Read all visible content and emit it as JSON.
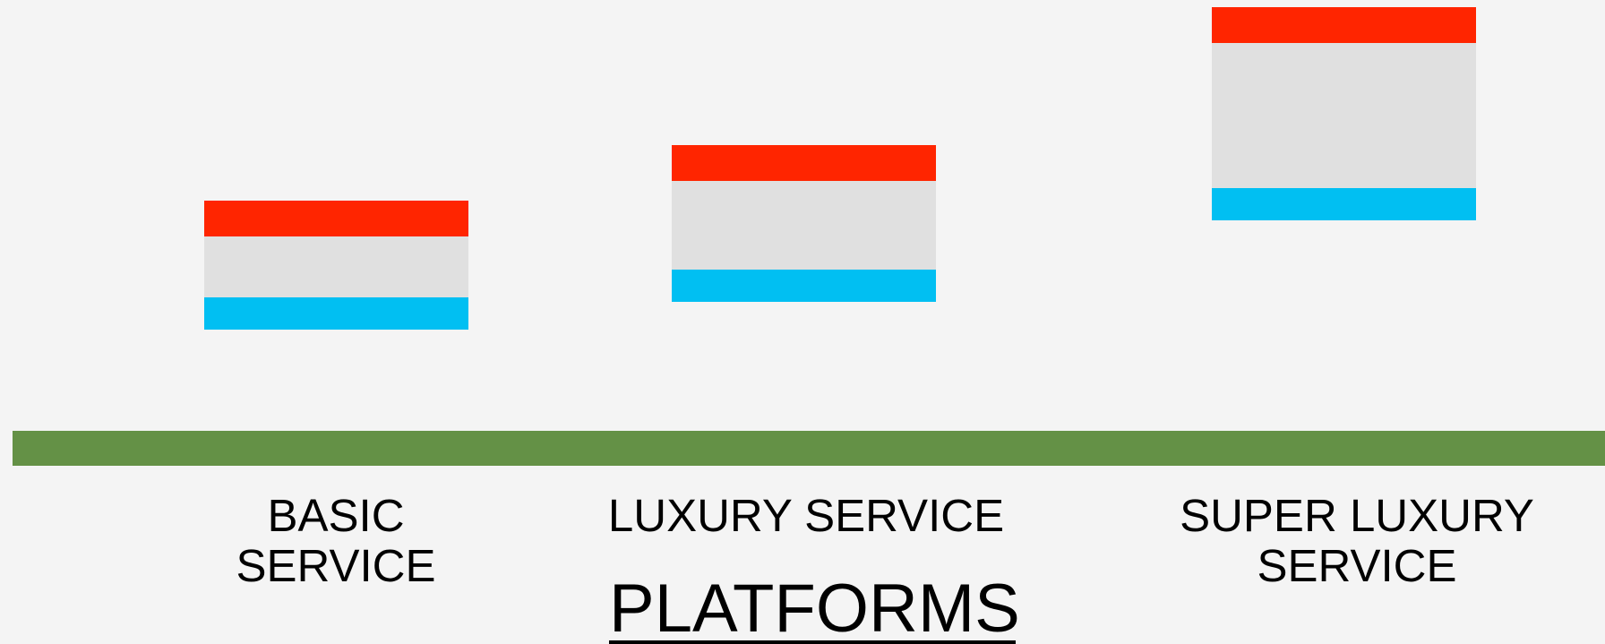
{
  "colors": {
    "background": "#f4f4f4",
    "band_top": "#ff2500",
    "band_middle": "#e0e0e0",
    "band_bottom": "#01bff2",
    "ground": "#649146",
    "text": "#000000"
  },
  "platforms": [
    {
      "label": "BASIC\nSERVICE"
    },
    {
      "label": "LUXURY SERVICE"
    },
    {
      "label": "SUPER LUXURY\nSERVICE"
    }
  ],
  "title": "PLATFORMS"
}
